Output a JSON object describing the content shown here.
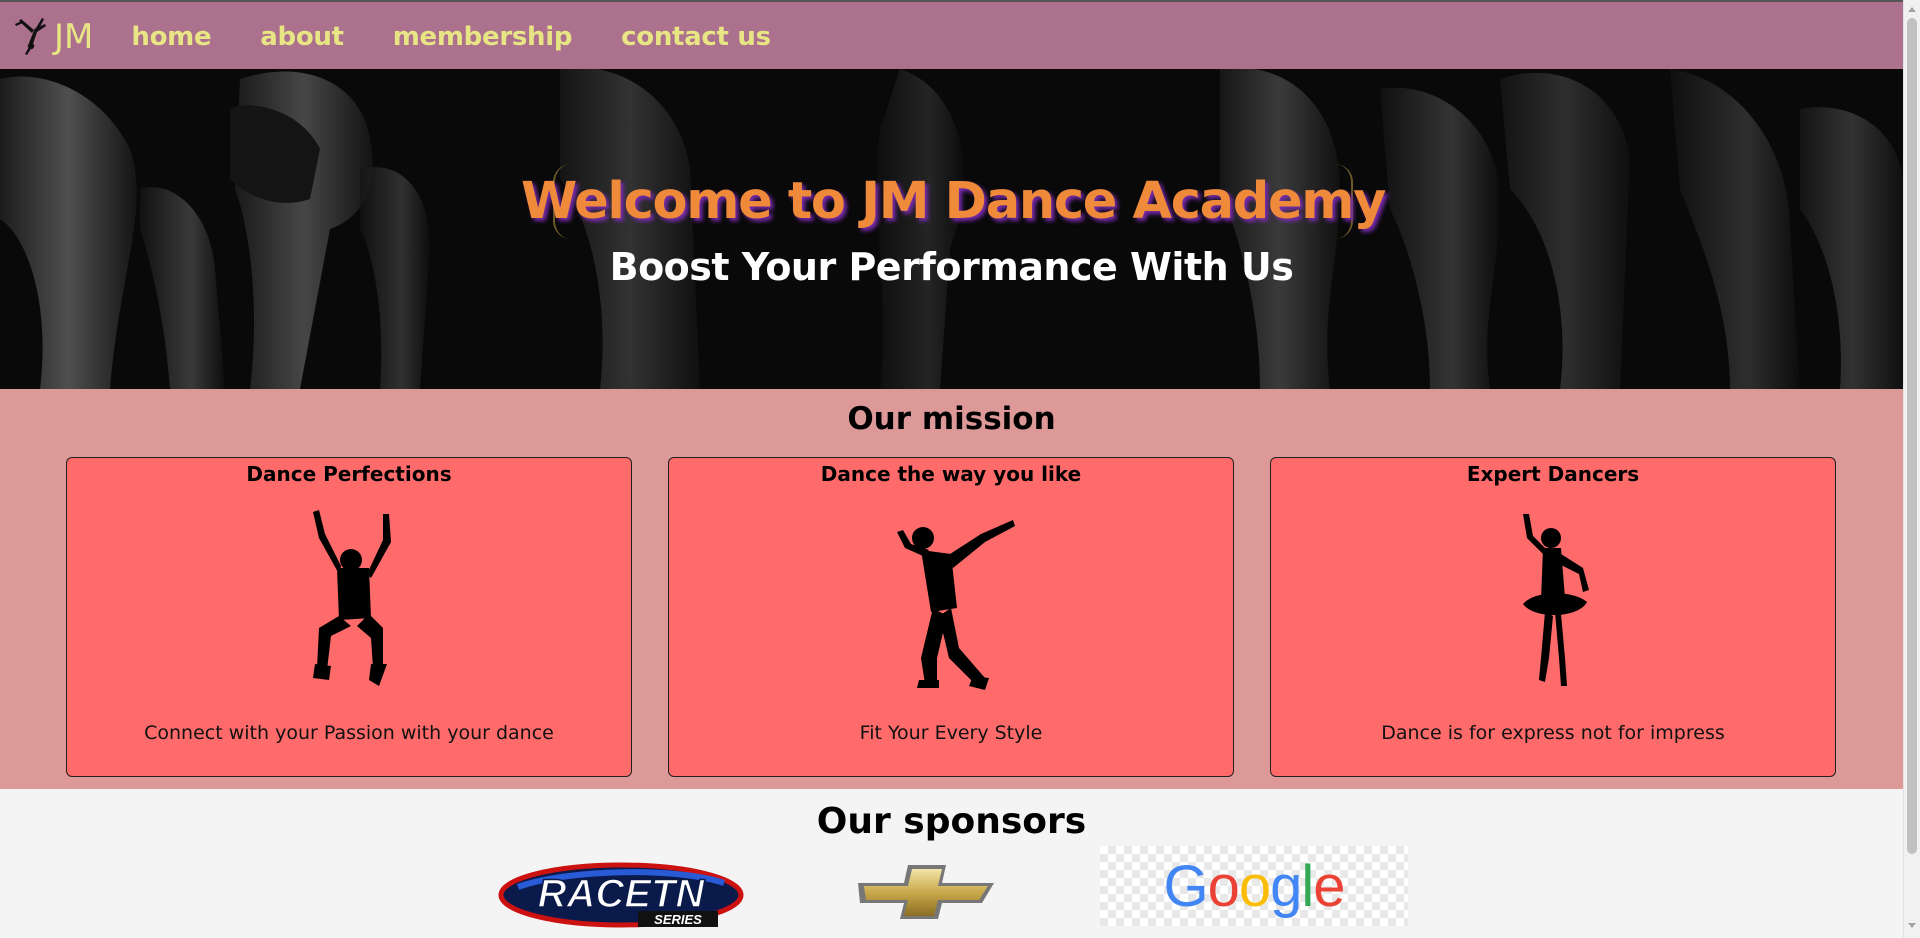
{
  "nav": {
    "logo_text": "JM",
    "links": [
      "home",
      "about",
      "membership",
      "contact us"
    ]
  },
  "hero": {
    "title": "Welcome to JM Dance Academy",
    "subtitle": "Boost Your Performance With Us"
  },
  "mission": {
    "title": "Our mission",
    "cards": [
      {
        "title": "Dance Perfections",
        "caption": "Connect with your Passion with your dance",
        "icon": "jumping-dancer-icon"
      },
      {
        "title": "Dance the way you like",
        "caption": "Fit Your Every Style",
        "icon": "hiphop-dancer-icon"
      },
      {
        "title": "Expert Dancers",
        "caption": "Dance is for express not for impress",
        "icon": "ballerina-icon"
      }
    ]
  },
  "sponsors": {
    "title": "Our sponsors",
    "logos": [
      {
        "name": "RaceTN Series",
        "text": "RACETN",
        "subtext": "SERIES"
      },
      {
        "name": "Chevrolet"
      },
      {
        "name": "Google",
        "text": "Google"
      }
    ]
  },
  "colors": {
    "navbar": "#ab718d",
    "nav_text": "#e8e585",
    "hero_title": "#ee8a3a",
    "mission_bg": "#dd9898",
    "card_bg": "#ff6b6b"
  }
}
